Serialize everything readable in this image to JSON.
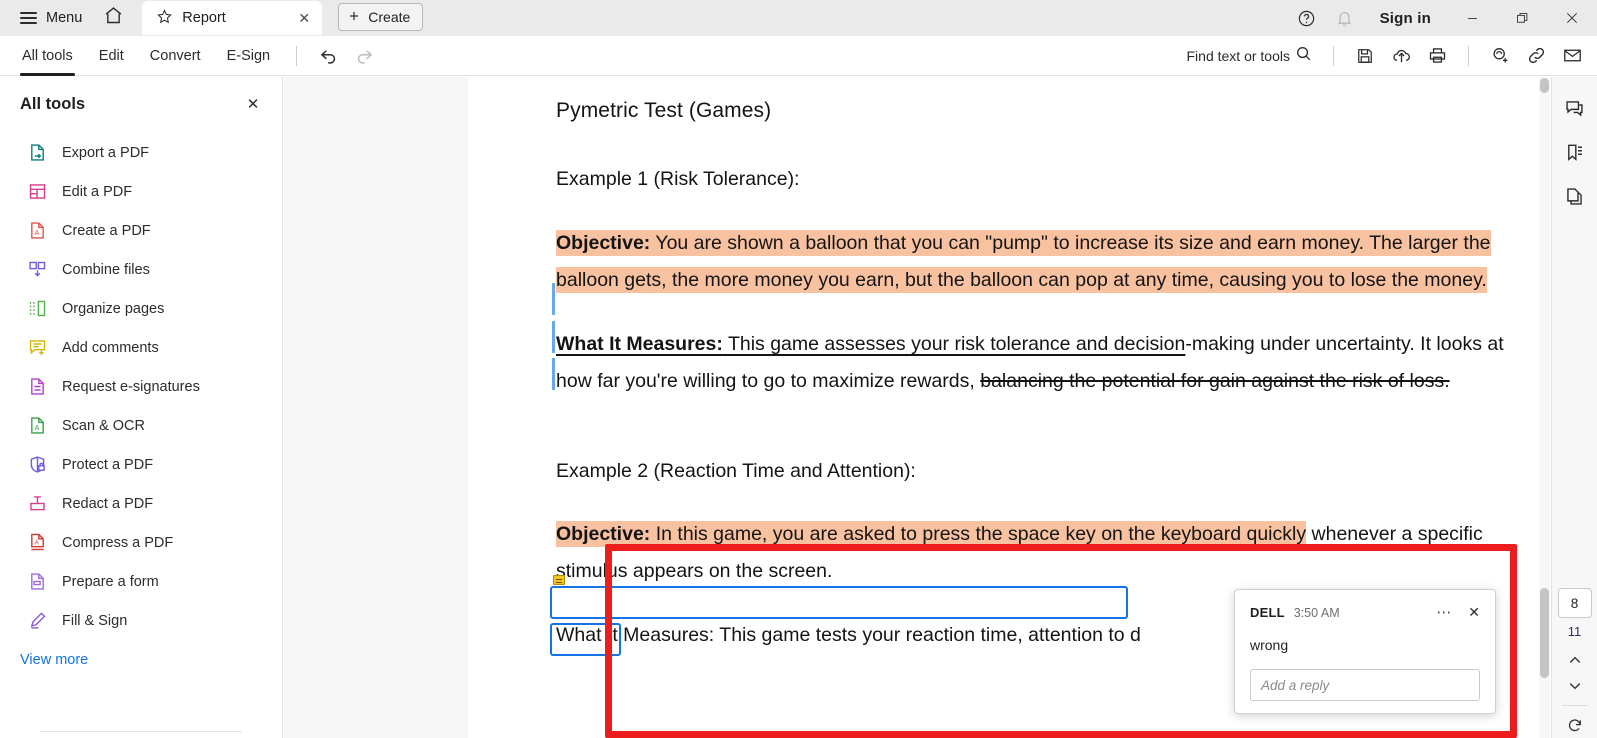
{
  "titlebar": {
    "menu_label": "Menu",
    "home_icon": "home-icon",
    "tab": {
      "title": "Report",
      "star_icon": "star-icon",
      "close_icon": "close-icon"
    },
    "create_label": "Create",
    "help_icon": "help-circle-icon",
    "bell_icon": "bell-icon",
    "signin_label": "Sign in",
    "minimize_icon": "minimize-icon",
    "restore_icon": "restore-icon",
    "close_icon": "window-close-icon"
  },
  "commandbar": {
    "tabs": [
      {
        "label": "All tools",
        "active": true
      },
      {
        "label": "Edit",
        "active": false
      },
      {
        "label": "Convert",
        "active": false
      },
      {
        "label": "E-Sign",
        "active": false
      }
    ],
    "undo_icon": "undo-icon",
    "redo_icon": "redo-icon",
    "find_label": "Find text or tools",
    "search_icon": "search-icon",
    "right_icons": [
      "save-icon",
      "upload-cloud-icon",
      "print-icon",
      "add-person-icon",
      "link-icon",
      "email-icon"
    ]
  },
  "leftpanel": {
    "title": "All tools",
    "close_icon": "close-icon",
    "view_more_label": "View more",
    "items": [
      {
        "label": "Export a PDF",
        "icon": "export-pdf-icon",
        "color": "#0d7c7c"
      },
      {
        "label": "Edit a PDF",
        "icon": "edit-pdf-icon",
        "color": "#d63f8c"
      },
      {
        "label": "Create a PDF",
        "icon": "create-pdf-icon",
        "color": "#e8514b"
      },
      {
        "label": "Combine files",
        "icon": "combine-files-icon",
        "color": "#6f5ce0"
      },
      {
        "label": "Organize pages",
        "icon": "organize-pages-icon",
        "color": "#56b14c"
      },
      {
        "label": "Add comments",
        "icon": "add-comments-icon",
        "color": "#d8b500"
      },
      {
        "label": "Request e-signatures",
        "icon": "request-esign-icon",
        "color": "#b341c9"
      },
      {
        "label": "Scan & OCR",
        "icon": "scan-ocr-icon",
        "color": "#3aa147"
      },
      {
        "label": "Protect a PDF",
        "icon": "protect-pdf-icon",
        "color": "#6f5ce0"
      },
      {
        "label": "Redact a PDF",
        "icon": "redact-pdf-icon",
        "color": "#d63f8c"
      },
      {
        "label": "Compress a PDF",
        "icon": "compress-pdf-icon",
        "color": "#d63b2e"
      },
      {
        "label": "Prepare a form",
        "icon": "prepare-form-icon",
        "color": "#9b6ce0"
      },
      {
        "label": "Fill & Sign",
        "icon": "fill-sign-icon",
        "color": "#8e57d1"
      }
    ]
  },
  "annotation_toolbar": {
    "tools": [
      {
        "name": "select-cursor-tool",
        "selected": false,
        "has_caret": true
      },
      {
        "name": "add-comment-tool",
        "selected": true,
        "has_caret": true
      },
      {
        "name": "text-edit-tool",
        "selected": false,
        "has_caret": true
      },
      {
        "name": "freehand-draw-tool",
        "selected": false,
        "has_caret": true
      },
      {
        "name": "line-tool",
        "selected": false,
        "has_caret": true
      },
      {
        "name": "highlighter-tool",
        "selected": false,
        "has_caret": true
      },
      {
        "name": "stamp-pin-tool",
        "selected": false,
        "has_caret": false
      }
    ],
    "color_swatch": "#f26522"
  },
  "annotations": {
    "arrow_color": "#e51c1c",
    "red_rect_color": "#ee1d1d",
    "highlight_color": "#f8c2a0",
    "selection_outline_color": "#1473e6"
  },
  "document": {
    "title": "Pymetric Test (Games)",
    "example1_heading": "Example 1 (Risk Tolerance):",
    "objective1_label": "Objective:",
    "objective1_text": " You are shown a balloon that you can \"pump\" to increase its size and earn money. The larger the balloon gets, the more money you earn, but the balloon can pop at any time, causing you to lose the money.",
    "measures1_label": "What It Measures:",
    "measures1_underlined": " This game assesses your risk tolerance and decision",
    "measures1_plain": "-making under uncertainty. It looks at how far you're willing to go to maximize rewards, ",
    "measures1_struck": "balancing the potential for gain against the risk of loss.",
    "example2_heading": "Example 2 (Reaction Time and Attention):",
    "objective2_label": "Objective:",
    "objective2_text_a": " In this game, you are asked to press the space key on the keyboard ",
    "objective2_text_b": "quickly",
    "objective2_text_c": " whenever a specific stimulus appears on the screen.",
    "measures2_text": "What It Measures: This game tests your reaction time, attention to d"
  },
  "comment_popup": {
    "author": "DELL",
    "time": "3:50 AM",
    "body": "wrong",
    "reply_placeholder": "Add a reply",
    "more_icon": "more-options-icon",
    "close_icon": "close-icon"
  },
  "rightrail": {
    "icons": [
      "comments-panel-icon",
      "bookmarks-panel-icon",
      "page-thumbnails-icon"
    ],
    "current_page": "8",
    "total_pages": "11",
    "prev_icon": "chevron-up-icon",
    "next_icon": "chevron-down-icon",
    "rotate_icon": "rotate-icon"
  }
}
